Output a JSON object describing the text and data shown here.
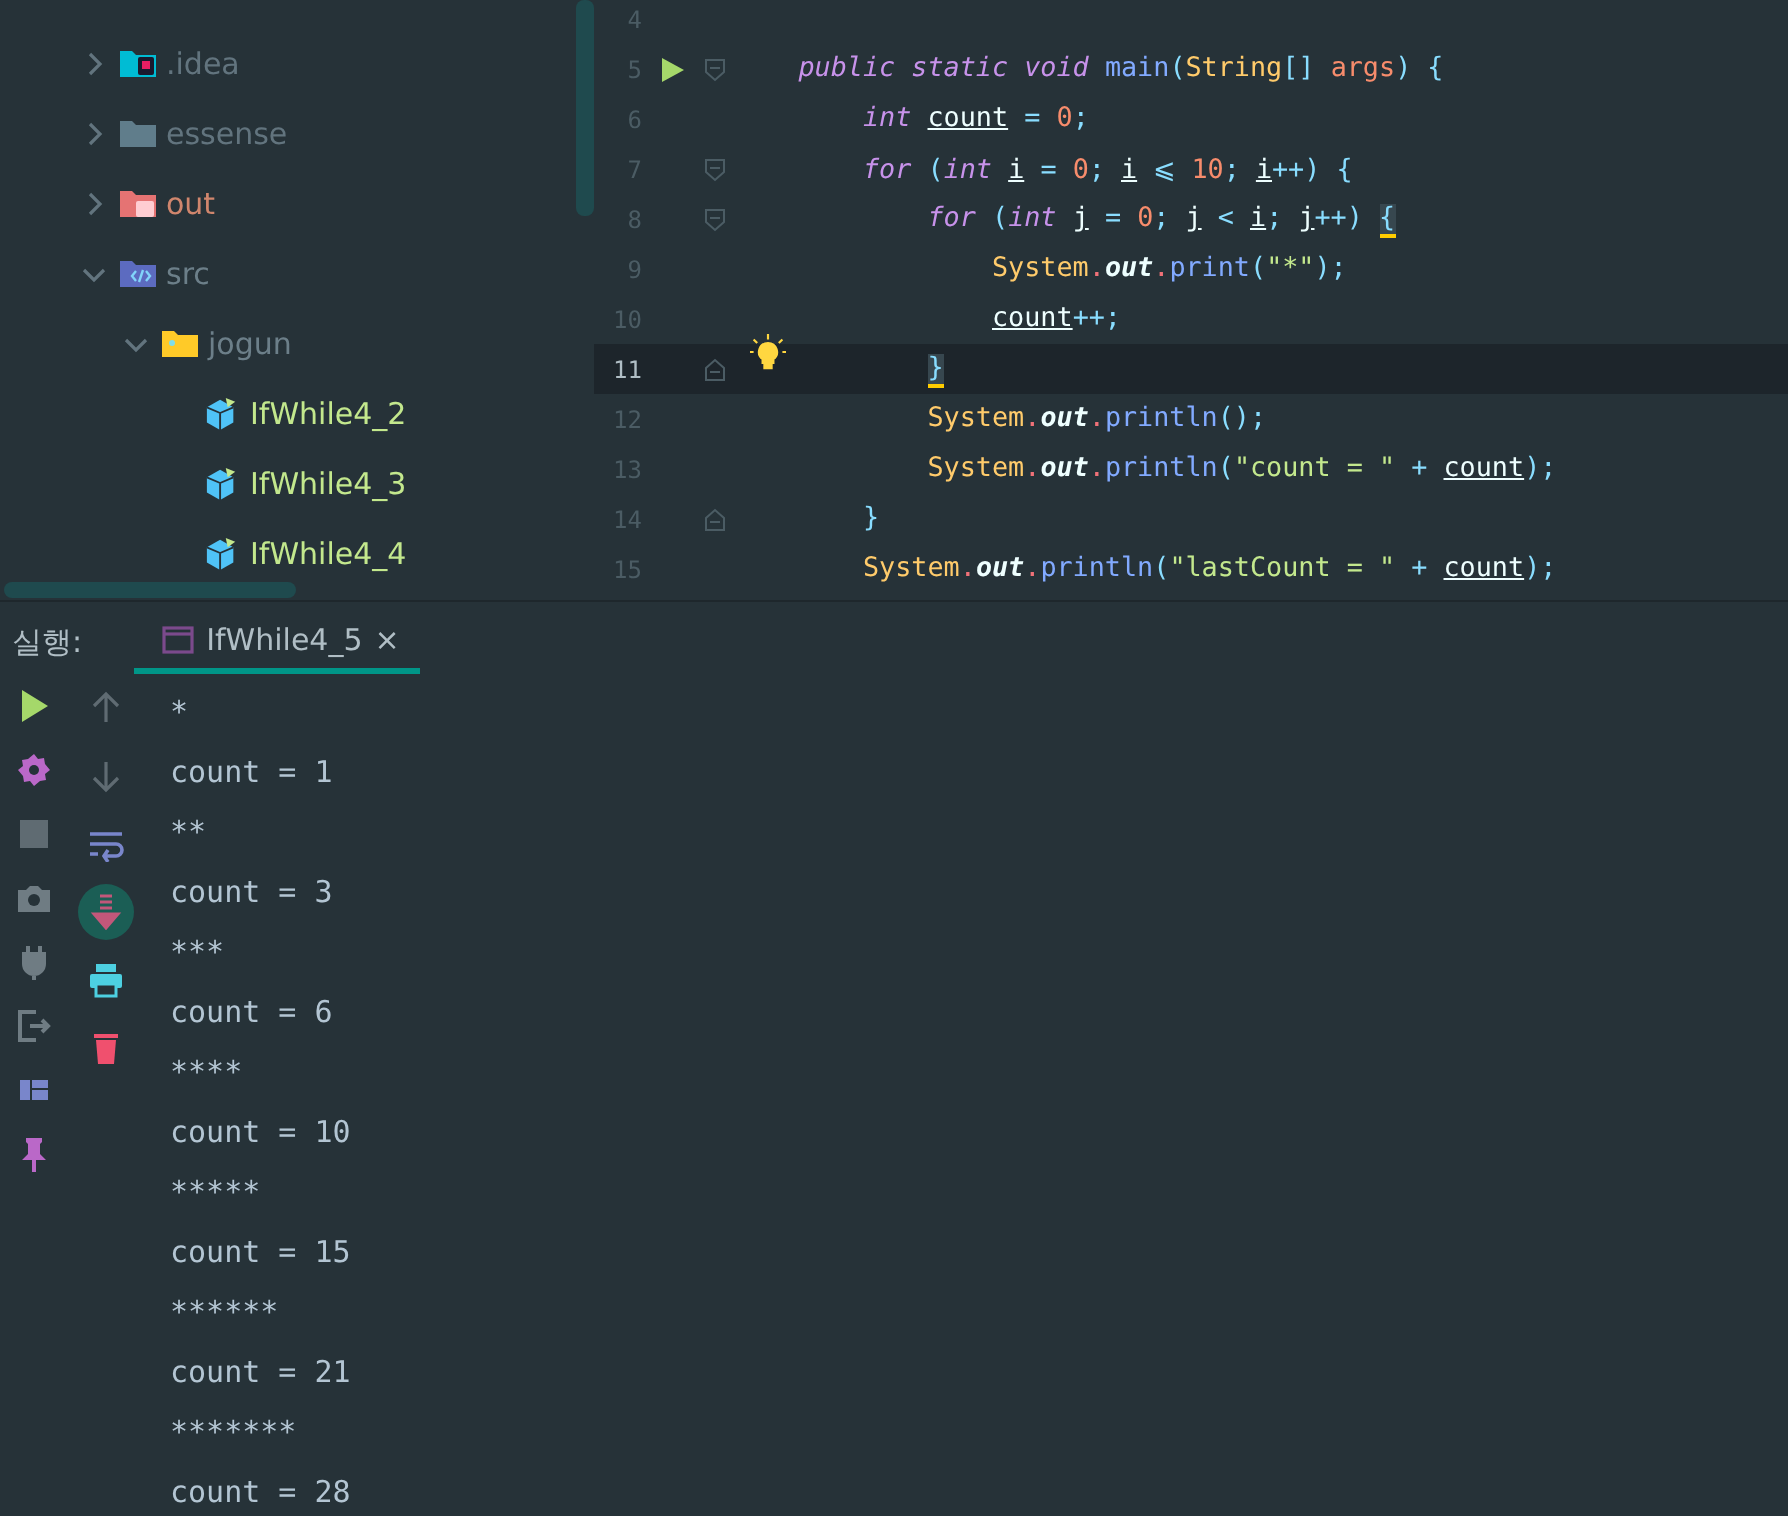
{
  "project_tree": {
    "items": [
      {
        "label": ".idea",
        "kind": "idea",
        "expanded": false
      },
      {
        "label": "essense",
        "kind": "folder",
        "expanded": false
      },
      {
        "label": "out",
        "kind": "excluded",
        "expanded": false
      },
      {
        "label": "src",
        "kind": "source",
        "expanded": true,
        "children": [
          {
            "label": "jogun",
            "kind": "package",
            "expanded": true,
            "children": [
              {
                "label": "IfWhile4_2",
                "kind": "class"
              },
              {
                "label": "IfWhile4_3",
                "kind": "class"
              },
              {
                "label": "IfWhile4_4",
                "kind": "class"
              }
            ]
          }
        ]
      }
    ]
  },
  "editor": {
    "lines": [
      {
        "number": "4",
        "current": false,
        "kind": "plain"
      },
      {
        "number": "5",
        "current": false,
        "kind": "run-fold-start",
        "tokens": [
          {
            "kind": "keyword",
            "text": "    public static void "
          },
          {
            "kind": "method",
            "text": "main"
          },
          {
            "kind": "punct",
            "text": "("
          },
          {
            "kind": "type",
            "text": "String"
          },
          {
            "kind": "punct",
            "text": "[] "
          },
          {
            "kind": "param",
            "text": "args"
          },
          {
            "kind": "punct",
            "text": ") {"
          }
        ]
      },
      {
        "number": "6",
        "current": false,
        "kind": "plain",
        "tokens": [
          {
            "kind": "keyword",
            "text": "        int "
          },
          {
            "kind": "var",
            "text": "count"
          },
          {
            "kind": "punct",
            "text": " = "
          },
          {
            "kind": "number",
            "text": "0"
          },
          {
            "kind": "punct",
            "text": ";"
          }
        ]
      },
      {
        "number": "7",
        "current": false,
        "kind": "fold-start",
        "tokens": [
          {
            "kind": "keyword",
            "text": "        for "
          },
          {
            "kind": "punct",
            "text": "("
          },
          {
            "kind": "keyword",
            "text": "int "
          },
          {
            "kind": "var",
            "text": "i"
          },
          {
            "kind": "punct",
            "text": " = "
          },
          {
            "kind": "number",
            "text": "0"
          },
          {
            "kind": "punct",
            "text": "; "
          },
          {
            "kind": "var",
            "text": "i"
          },
          {
            "kind": "punct",
            "text": " ⩽ "
          },
          {
            "kind": "number",
            "text": "10"
          },
          {
            "kind": "punct",
            "text": "; "
          },
          {
            "kind": "var",
            "text": "i"
          },
          {
            "kind": "punct",
            "text": "++) {"
          }
        ]
      },
      {
        "number": "8",
        "current": false,
        "kind": "fold-start",
        "tokens": [
          {
            "kind": "keyword",
            "text": "            for "
          },
          {
            "kind": "punct",
            "text": "("
          },
          {
            "kind": "keyword",
            "text": "int "
          },
          {
            "kind": "var",
            "text": "j"
          },
          {
            "kind": "punct",
            "text": " = "
          },
          {
            "kind": "number",
            "text": "0"
          },
          {
            "kind": "punct",
            "text": "; "
          },
          {
            "kind": "var",
            "text": "j"
          },
          {
            "kind": "punct",
            "text": " < "
          },
          {
            "kind": "var",
            "text": "i"
          },
          {
            "kind": "punct",
            "text": "; "
          },
          {
            "kind": "var",
            "text": "j"
          },
          {
            "kind": "punct",
            "text": "++) "
          },
          {
            "kind": "brace-match",
            "text": "{"
          }
        ]
      },
      {
        "number": "9",
        "current": false,
        "kind": "plain",
        "tokens": [
          {
            "kind": "type",
            "text": "                System"
          },
          {
            "kind": "dot",
            "text": "."
          },
          {
            "kind": "field",
            "text": "out"
          },
          {
            "kind": "dot",
            "text": "."
          },
          {
            "kind": "method",
            "text": "print"
          },
          {
            "kind": "punct",
            "text": "("
          },
          {
            "kind": "string",
            "text": "\"*\""
          },
          {
            "kind": "punct",
            "text": ");"
          }
        ]
      },
      {
        "number": "10",
        "current": false,
        "kind": "plain",
        "tokens": [
          {
            "kind": "var",
            "text": "                count"
          },
          {
            "kind": "punct",
            "text": "++;"
          }
        ]
      },
      {
        "number": "11",
        "current": true,
        "kind": "bulb-fold-end",
        "tokens": [
          {
            "kind": "brace-match",
            "text": "            }"
          }
        ]
      },
      {
        "number": "12",
        "current": false,
        "kind": "plain",
        "tokens": [
          {
            "kind": "type",
            "text": "            System"
          },
          {
            "kind": "dot",
            "text": "."
          },
          {
            "kind": "field",
            "text": "out"
          },
          {
            "kind": "dot",
            "text": "."
          },
          {
            "kind": "method",
            "text": "println"
          },
          {
            "kind": "punct",
            "text": "();"
          }
        ]
      },
      {
        "number": "13",
        "current": false,
        "kind": "plain",
        "tokens": [
          {
            "kind": "type",
            "text": "            System"
          },
          {
            "kind": "dot",
            "text": "."
          },
          {
            "kind": "field",
            "text": "out"
          },
          {
            "kind": "dot",
            "text": "."
          },
          {
            "kind": "method",
            "text": "println"
          },
          {
            "kind": "punct",
            "text": "("
          },
          {
            "kind": "string",
            "text": "\"count = \""
          },
          {
            "kind": "punct",
            "text": " + "
          },
          {
            "kind": "var",
            "text": "count"
          },
          {
            "kind": "punct",
            "text": ");"
          }
        ]
      },
      {
        "number": "14",
        "current": false,
        "kind": "fold-end",
        "tokens": [
          {
            "kind": "punct",
            "text": "        }"
          }
        ]
      },
      {
        "number": "15",
        "current": false,
        "kind": "plain",
        "tokens": [
          {
            "kind": "type",
            "text": "        System"
          },
          {
            "kind": "dot",
            "text": "."
          },
          {
            "kind": "field",
            "text": "out"
          },
          {
            "kind": "dot",
            "text": "."
          },
          {
            "kind": "method",
            "text": "println"
          },
          {
            "kind": "punct",
            "text": "("
          },
          {
            "kind": "string",
            "text": "\"lastCount = \""
          },
          {
            "kind": "punct",
            "text": " + "
          },
          {
            "kind": "var",
            "text": "count"
          },
          {
            "kind": "punct",
            "text": ");"
          }
        ]
      }
    ]
  },
  "run_panel": {
    "label": "실행:",
    "tabs": [
      {
        "label": "IfWhile4_5",
        "close": "×",
        "selected": true
      }
    ],
    "scroll_to_end": {
      "on": true
    },
    "output": [
      "*",
      "count = 1",
      "**",
      "count = 3",
      "***",
      "count = 6",
      "****",
      "count = 10",
      "*****",
      "count = 15",
      "******",
      "count = 21",
      "*******",
      "count = 28"
    ]
  }
}
